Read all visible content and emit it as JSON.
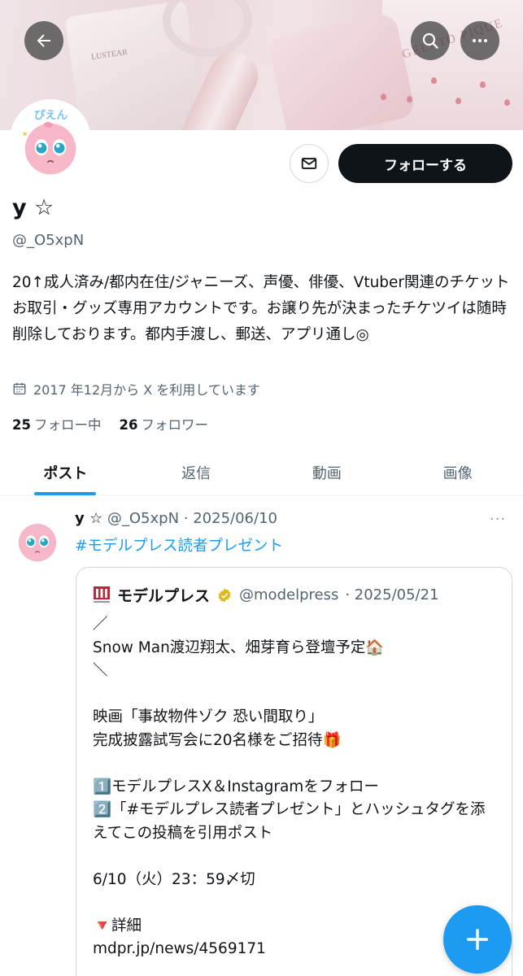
{
  "banner": {
    "brand_text": "GELATO PIQUE",
    "product_text": "LUSTEAR"
  },
  "nav": {
    "back_icon": "arrow-left-icon",
    "search_icon": "search-icon",
    "more_icon": "more-horizontal-icon"
  },
  "profile": {
    "display_name": "y ☆",
    "handle": "@_O5xpN",
    "bio": "20↑成人済み/都内在住/ジャニーズ、声優、俳優、Vtuber関連のチケットお取引・グッズ専用アカウントです。お譲り先が決まったチケツイは随時削除しております。都内手渡し、郵送、アプリ通し◎",
    "joined": "2017 年12月から X を利用しています",
    "following_count": "25",
    "following_label": "フォロー中",
    "followers_count": "26",
    "followers_label": "フォロワー",
    "follow_button": "フォローする",
    "avatar_text": "ぴえん"
  },
  "tabs": [
    {
      "label": "ポスト",
      "active": true
    },
    {
      "label": "返信",
      "active": false
    },
    {
      "label": "動画",
      "active": false
    },
    {
      "label": "画像",
      "active": false
    }
  ],
  "post": {
    "author_name": "y ☆",
    "author_handle": "@_O5xpN",
    "date": "· 2025/06/10",
    "more": "···",
    "text": "#モデルプレス読者プレゼント",
    "quote": {
      "author_name": "モデルプレス",
      "author_handle": "@modelpress",
      "date": "· 2025/05/21",
      "body": "／\nSnow Man渡辺翔太、畑芽育ら登壇予定🏠\n＼\n\n映画「事故物件ゾク 恐い間取り」\n完成披露試写会に20名様をご招待🎁\n\n1️⃣モデルプレスX＆Instagramをフォロー\n2️⃣「#モデルプレス読者プレゼント」とハッシュタグを添えてこの投稿を引用ポスト\n\n6/10（火）23：59〆切\n\n🔻詳細\nmdpr.jp/news/4569171"
    }
  },
  "colors": {
    "accent": "#1d9bf0",
    "text": "#0f1419",
    "muted": "#536471",
    "button_dark": "#0f1419"
  }
}
